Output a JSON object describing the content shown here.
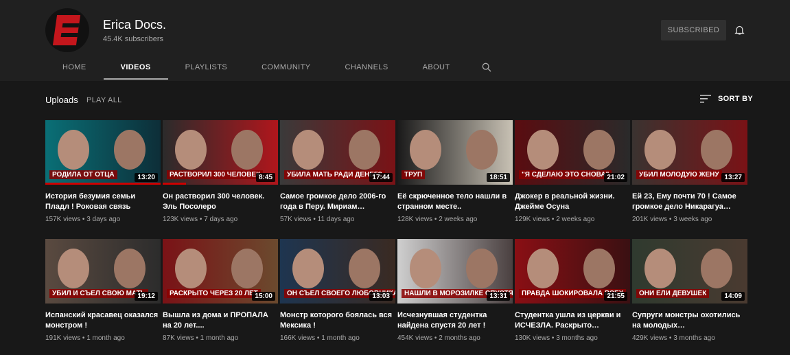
{
  "channel": {
    "name": "Erica Docs.",
    "subscribers": "45.4K subscribers",
    "subscribe_label": "SUBSCRIBED"
  },
  "tabs": [
    "HOME",
    "VIDEOS",
    "PLAYLISTS",
    "COMMUNITY",
    "CHANNELS",
    "ABOUT"
  ],
  "active_tab": "VIDEOS",
  "section": {
    "title": "Uploads",
    "play_all": "PLAY ALL",
    "sort_label": "SORT BY"
  },
  "videos": [
    {
      "title": "История безумия семьи Пладл ! Роковая связь",
      "views": "157K views",
      "age": "3 days ago",
      "duration": "13:20",
      "overlay": "РОДИЛА ОТ ОТЦА",
      "watched": 1.0,
      "colors": [
        "#0a6f76",
        "#0d2e38"
      ]
    },
    {
      "title": "Он растворил 300 человек. Эль Посолеро",
      "views": "123K views",
      "age": "7 days ago",
      "duration": "8:45",
      "overlay": "РАСТВОРИЛ 300 ЧЕЛОВЕК",
      "watched": 0.2,
      "colors": [
        "#2b2b2b",
        "#b0161c"
      ]
    },
    {
      "title": "Самое громкое дело 2006-го года в Перу. Мириам…",
      "views": "57K views",
      "age": "11 days ago",
      "duration": "17:44",
      "overlay": "УБИЛА МАТЬ РАДИ ДЕНЕГ?",
      "watched": 0,
      "colors": [
        "#3a3a3a",
        "#7a1216"
      ]
    },
    {
      "title": "Её скрюченное тело нашли в странном месте..",
      "views": "128K views",
      "age": "2 weeks ago",
      "duration": "18:51",
      "overlay": "ТРУП",
      "watched": 0,
      "colors": [
        "#1a1a1a",
        "#c8c1b4"
      ]
    },
    {
      "title": "Джокер в реальной жизни. Джейме Осуна",
      "views": "129K views",
      "age": "2 weeks ago",
      "duration": "21:02",
      "overlay": "\"Я СДЕЛАЮ ЭТО СНОВА\"",
      "watched": 0,
      "colors": [
        "#5a0c10",
        "#2a2a2a"
      ]
    },
    {
      "title": "Ей 23, Ему почти 70 ! Самое громкое дело Никарагуа…",
      "views": "201K views",
      "age": "3 weeks ago",
      "duration": "13:27",
      "overlay": "УБИЛ МОЛОДУЮ ЖЕНУ",
      "watched": 0,
      "colors": [
        "#3a3330",
        "#7a1216"
      ]
    },
    {
      "title": "Испанский красавец оказался монстром !",
      "views": "191K views",
      "age": "1 month ago",
      "duration": "19:12",
      "overlay": "УБИЛ И СЪЕЛ СВОЮ МАТЬ",
      "watched": 0,
      "colors": [
        "#5a4a40",
        "#2c2c2c"
      ]
    },
    {
      "title": "Вышла из дома и ПРОПАЛА на 20 лет....",
      "views": "87K views",
      "age": "1 month ago",
      "duration": "15:00",
      "overlay": "РАСКРЫТО ЧЕРЕЗ 20 ЛЕТ",
      "watched": 0,
      "colors": [
        "#7a1216",
        "#6b4a2e"
      ]
    },
    {
      "title": "Монстр которого боялась вся Мексика !",
      "views": "166K views",
      "age": "1 month ago",
      "duration": "13:03",
      "overlay": "ОН СЪЕЛ СВОЕГО ЛЮБОВНИКА",
      "watched": 0,
      "colors": [
        "#1e3550",
        "#3a2a22"
      ]
    },
    {
      "title": "Исчезнувшая студентка найдена спустя 20 лет !",
      "views": "454K views",
      "age": "2 months ago",
      "duration": "13:31",
      "overlay": "НАШЛИ В МОРОЗИЛКЕ СПУСТЯ 20 ЛЕТ",
      "watched": 0,
      "colors": [
        "#cfcfcf",
        "#4a4040"
      ]
    },
    {
      "title": "Студентка ушла из церкви и ИСЧЕЗЛА. Раскрыто…",
      "views": "130K views",
      "age": "3 months ago",
      "duration": "21:55",
      "overlay": "ПРАВДА ШОКИРОВАЛА ВСЕХ",
      "watched": 0,
      "colors": [
        "#8a0f14",
        "#3a1012"
      ]
    },
    {
      "title": "Супруги монстры охотились на молодых…",
      "views": "429K views",
      "age": "3 months ago",
      "duration": "14:09",
      "overlay": "ОНИ ЕЛИ ДЕВУШЕК",
      "watched": 0,
      "colors": [
        "#2f3a2f",
        "#4a3a30"
      ]
    }
  ]
}
